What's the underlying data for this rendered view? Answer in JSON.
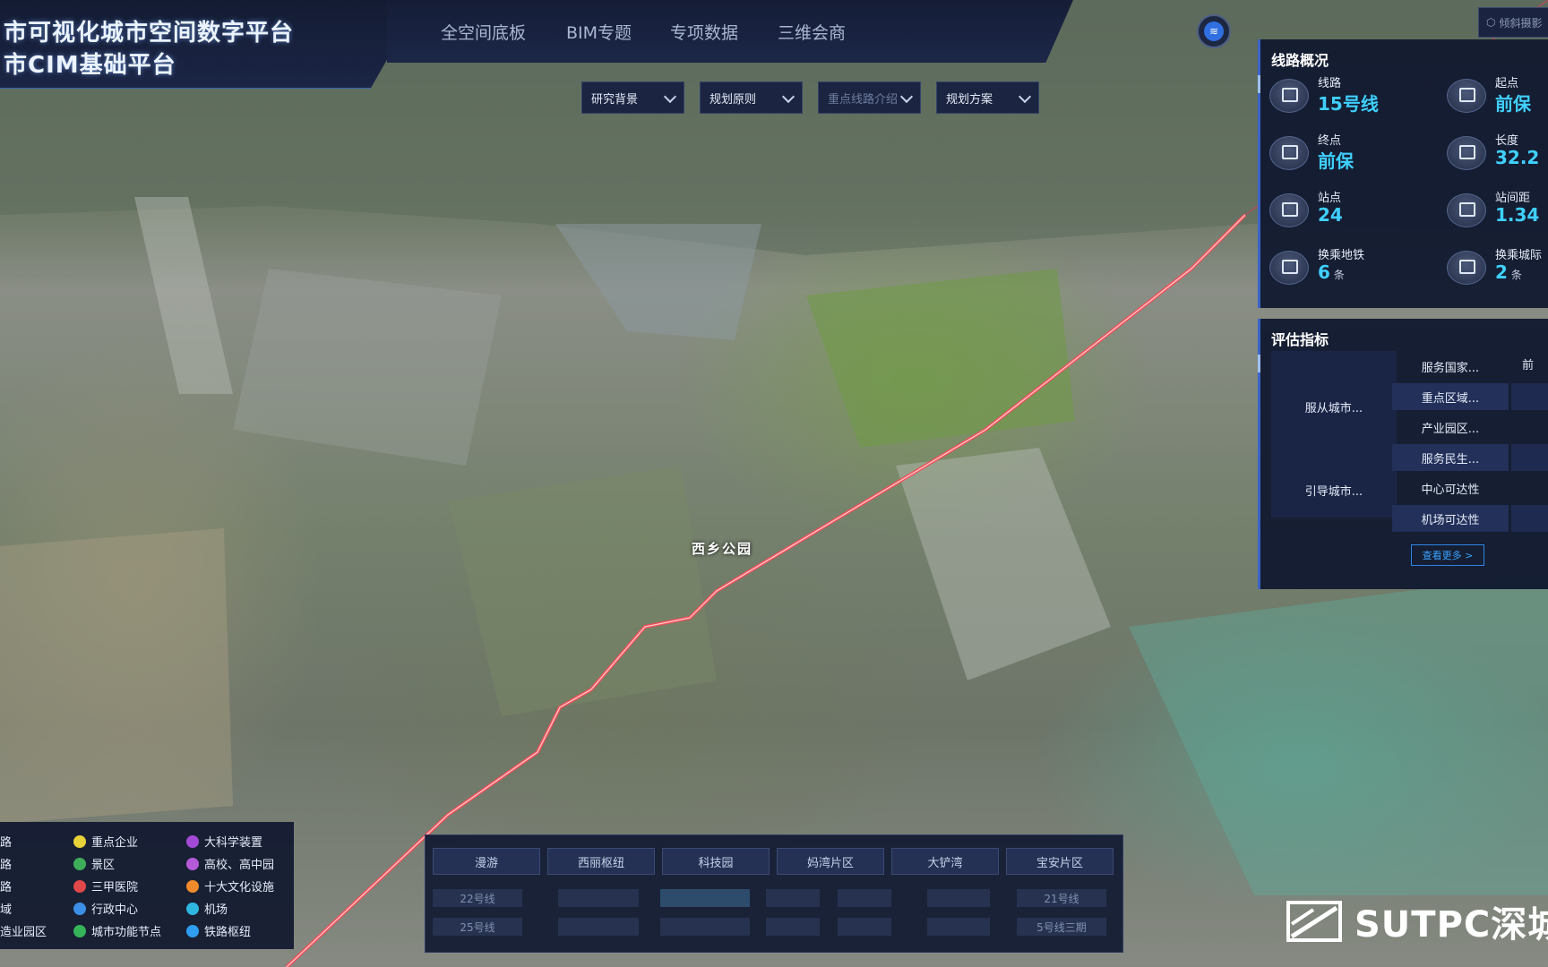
{
  "header": {
    "title_line1": "市可视化城市空间数字平台",
    "title_line2": "市CIM基础平台",
    "nav": [
      "全空间底板",
      "BIM专题",
      "专项数据",
      "三维会商"
    ],
    "tilt_label": "倾斜摄影"
  },
  "toolbar": {
    "dropdowns": [
      {
        "label": "研究背景",
        "dim": false
      },
      {
        "label": "规划原则",
        "dim": false
      },
      {
        "label": "重点线路介绍",
        "dim": true
      },
      {
        "label": "规划方案",
        "dim": false
      }
    ]
  },
  "map": {
    "place_label": "西乡公园",
    "route_color": "#f0505a"
  },
  "line_overview": {
    "title": "线路概况",
    "stats": [
      {
        "label": "线路",
        "value": "15号线",
        "unit": ""
      },
      {
        "label": "起点",
        "value": "前保",
        "unit": ""
      },
      {
        "label": "终点",
        "value": "前保",
        "unit": ""
      },
      {
        "label": "长度",
        "value": "32.2",
        "unit": ""
      },
      {
        "label": "站点",
        "value": "24",
        "unit": ""
      },
      {
        "label": "站间距",
        "value": "1.34",
        "unit": ""
      },
      {
        "label": "换乘地铁",
        "value": "6",
        "unit": "条"
      },
      {
        "label": "换乘城际",
        "value": "2",
        "unit": "条"
      }
    ]
  },
  "evaluation": {
    "title": "评估指标",
    "groups": [
      "服从城市...",
      "引导城市..."
    ],
    "items": [
      {
        "name": "服务国家...",
        "value": "前"
      },
      {
        "name": "重点区域...",
        "value": ""
      },
      {
        "name": "产业园区...",
        "value": ""
      },
      {
        "name": "服务民生...",
        "value": ""
      },
      {
        "name": "中心可达性",
        "value": ""
      },
      {
        "name": "机场可达性",
        "value": ""
      }
    ],
    "more_label": "查看更多 >"
  },
  "legend": {
    "col0": [
      "路",
      "路",
      "路",
      "域",
      "造业园区"
    ],
    "col1": [
      {
        "label": "重点企业",
        "color": "#e8d23a"
      },
      {
        "label": "景区",
        "color": "#3fae5a"
      },
      {
        "label": "三甲医院",
        "color": "#e0484a"
      },
      {
        "label": "行政中心",
        "color": "#3b8fe6"
      },
      {
        "label": "城市功能节点",
        "color": "#36b45a"
      }
    ],
    "col2": [
      {
        "label": "大科学装置",
        "color": "#a24ad6"
      },
      {
        "label": "高校、高中园",
        "color": "#b45ad8"
      },
      {
        "label": "十大文化设施",
        "color": "#f08a2a"
      },
      {
        "label": "机场",
        "color": "#2fb6e0"
      },
      {
        "label": "铁路枢纽",
        "color": "#2f9ef0"
      }
    ]
  },
  "bottom_tabs": {
    "tabs": [
      "漫游",
      "西丽枢纽",
      "科技园",
      "妈湾片区",
      "大铲湾",
      "宝安片区"
    ],
    "row1": [
      "22号线",
      "",
      "",
      "",
      "",
      "21号线"
    ],
    "row2": [
      "25号线",
      "",
      "",
      "",
      "",
      "5号线三期"
    ]
  },
  "logo": {
    "text": "SUTPC深城"
  }
}
